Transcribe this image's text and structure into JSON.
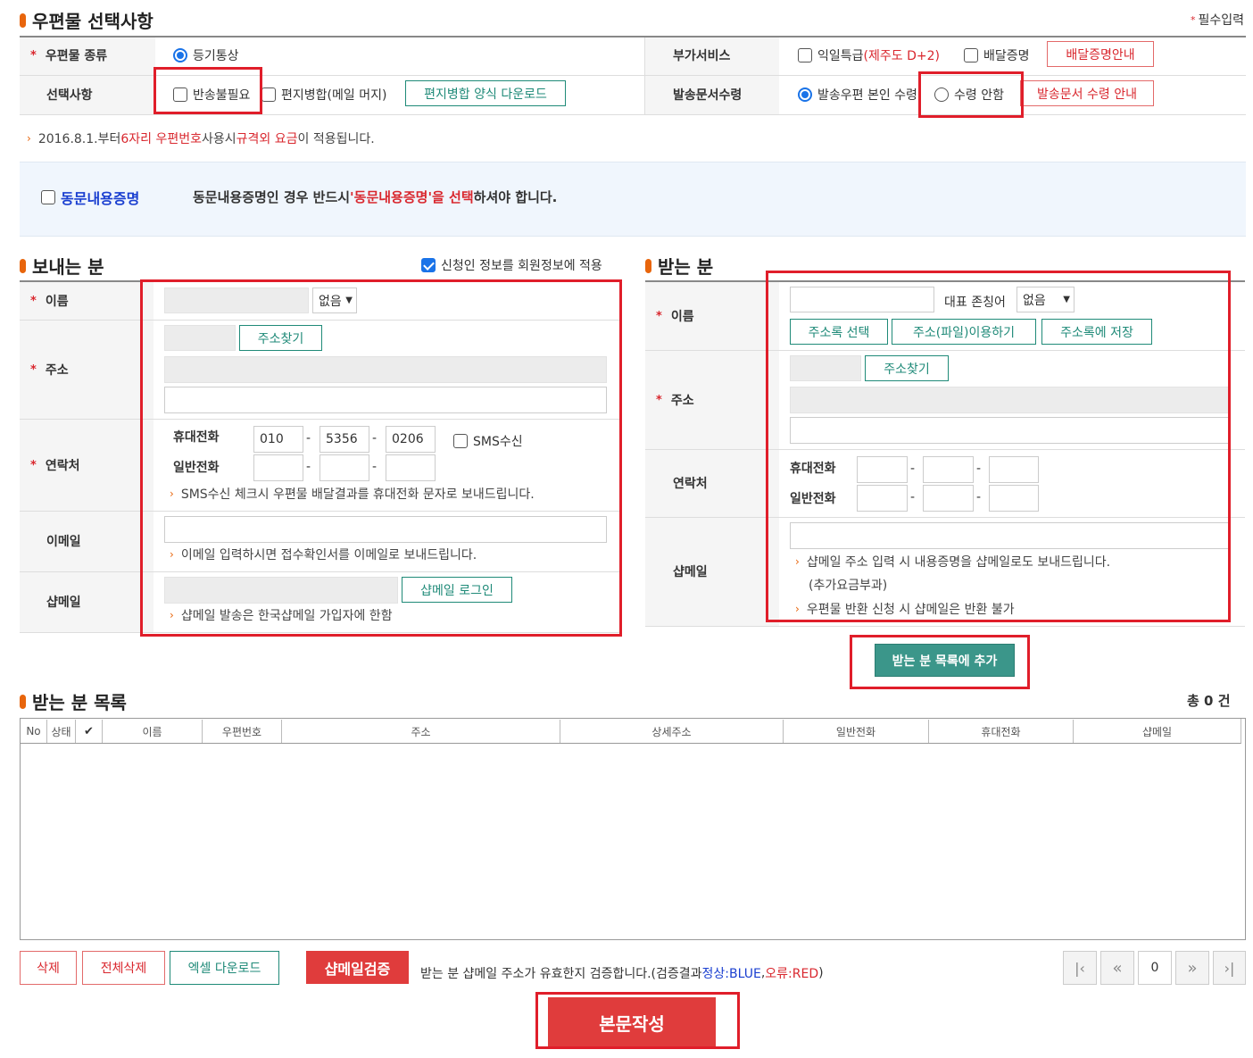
{
  "options_section": {
    "title": "우편물 선택사항",
    "required_mark": "*",
    "required_text": "필수입력",
    "mail_type_label": "우편물 종류",
    "mail_type_value": "등기통상",
    "extra_service_label": "부가서비스",
    "next_day_label": "익일특급",
    "next_day_note": "(제주도 D+2)",
    "delivery_proof_label": "배달증명",
    "delivery_proof_guide_button": "배달증명안내",
    "select_label": "선택사항",
    "no_return_label": "반송불필요",
    "mail_merge_label": "편지병합(메일 머지)",
    "mail_merge_download_button": "편지병합 양식 다운로드",
    "doc_receive_label": "발송문서수령",
    "doc_receive_self": "발송우편 본인 수령",
    "doc_receive_none": "수령 안함",
    "doc_receive_guide_button": "발송문서 수령 안내"
  },
  "notice": {
    "prefix": "2016.8.1.부터 ",
    "highlight1": "6자리 우편번호",
    "middle": " 사용시 ",
    "highlight2": "규격외 요금",
    "suffix": "이 적용됩니다."
  },
  "same_content": {
    "checkbox_label": "동문내용증명",
    "desc_prefix": "동문내용증명인 경우 반드시 ",
    "desc_highlight": "'동문내용증명'을 선택",
    "desc_suffix": "하셔야 합니다."
  },
  "sender": {
    "title": "보내는 분",
    "apply_member_label": "신청인 정보를 회원정보에 적용",
    "name_label": "이름",
    "title_select": "없음",
    "address_label": "주소",
    "find_address_button": "주소찾기",
    "contact_label": "연락처",
    "mobile_label": "휴대전화",
    "mobile_1": "010",
    "mobile_2": "5356",
    "mobile_3": "0206",
    "dash": "-",
    "sms_label": "SMS수신",
    "phone_label": "일반전화",
    "sms_note": "SMS수신 체크시 우편물 배달결과를 휴대전화 문자로 보내드립니다.",
    "email_label": "이메일",
    "email_note": "이메일 입력하시면 접수확인서를 이메일로 보내드립니다.",
    "shopmail_label": "샵메일",
    "shopmail_login_button": "샵메일 로그인",
    "shopmail_note": "샵메일 발송은 한국샵메일 가입자에 한함"
  },
  "receiver": {
    "title": "받는 분",
    "name_label": "이름",
    "honorific_label": "대표 존칭어",
    "honorific_select": "없음",
    "address_book_button": "주소록 선택",
    "address_file_button": "주소(파일)이용하기",
    "save_address_button": "주소록에 저장",
    "address_label": "주소",
    "find_address_button": "주소찾기",
    "contact_label": "연락처",
    "mobile_label": "휴대전화",
    "phone_label": "일반전화",
    "dash": "-",
    "shopmail_label": "샵메일",
    "shopmail_note1": "샵메일 주소 입력 시 내용증명을 샵메일로도 보내드립니다.",
    "shopmail_note1b": "(추가요금부과)",
    "shopmail_note2": "우편물 반환 신청 시 샵메일은 반환 불가",
    "add_button": "받는 분 목록에 추가"
  },
  "list": {
    "title": "받는 분 목록",
    "total_prefix": "총",
    "total_count": "0",
    "total_suffix": "건",
    "columns": [
      "No",
      "상태",
      "✔",
      "이름",
      "우편번호",
      "주소",
      "상세주소",
      "일반전화",
      "휴대전화",
      "샵메일"
    ],
    "delete_button": "삭제",
    "delete_all_button": "전체삭제",
    "excel_button": "엑셀 다운로드",
    "verify_button": "샵메일검증",
    "verify_desc": "받는 분 샵메일 주소가 유효한지 검증합니다.(검증결과 ",
    "normal_label": "정상:BLUE",
    "comma": ", ",
    "error_label": "오류:RED",
    "close_paren": ")",
    "page_value": "0"
  },
  "write_button": "본문작성",
  "colors": {
    "accent_green": "#1f8a78",
    "accent_red": "#e03c3c",
    "highlight_box": "#e01e2a",
    "bullet": "#e8650c"
  }
}
